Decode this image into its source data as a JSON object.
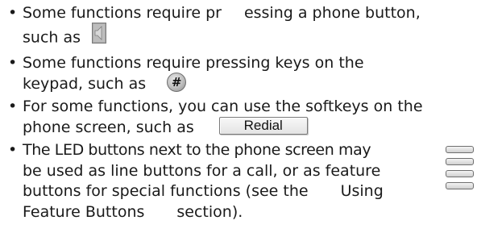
{
  "bullets": [
    {
      "marker": "•",
      "line1_a": "Some functions require pr",
      "line1_b": "essing a phone button,",
      "line2_a": "such as",
      "icon": "speaker-icon"
    },
    {
      "marker": "•",
      "line1": "Some functions require pressing keys on the",
      "line2_a": "keypad, such as",
      "key_label": "#"
    },
    {
      "marker": "•",
      "line1": "For some functions, you can use the softkeys on the",
      "line2_a": "phone screen, such as",
      "softkey_label": "Redial"
    },
    {
      "marker": "•",
      "line1": "The LED buttons next to the phone screen may",
      "line2": "be used as line buttons for a call, or as feature",
      "line3_a": "buttons for special functions (see the",
      "line3_b": "Using",
      "line4_a": "Feature Buttons",
      "line4_b": "section)."
    }
  ],
  "led_buttons_count": 4,
  "colors": {
    "text": "#1a1a1a",
    "icon_gray": "#9a9a9a",
    "border": "#6f6f6f"
  }
}
